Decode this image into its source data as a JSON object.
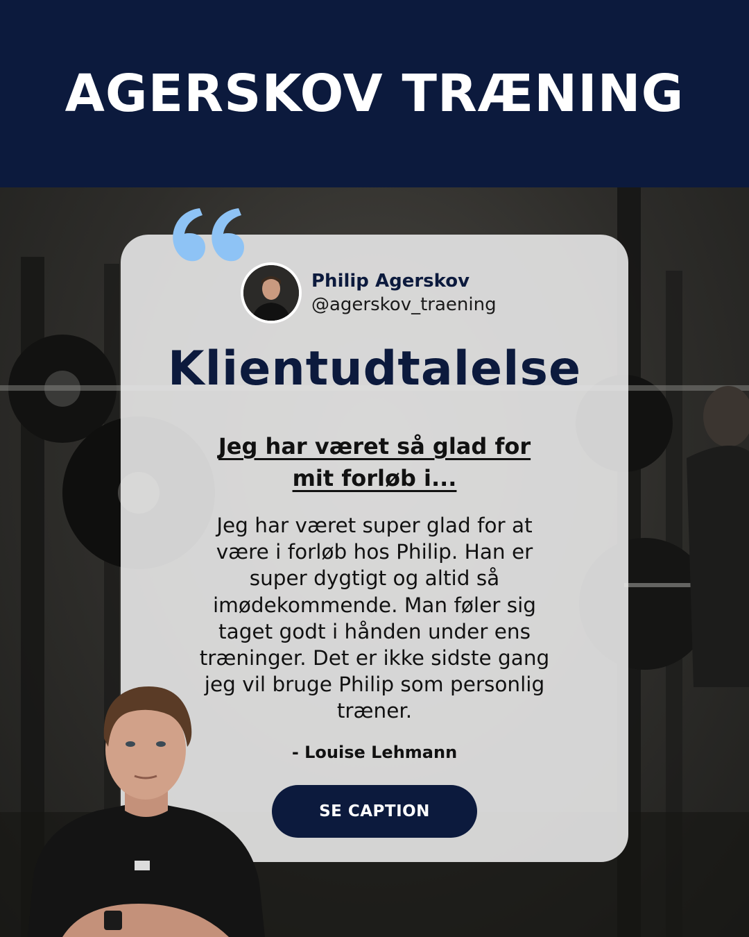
{
  "header": {
    "brand": "AGERSKOV TRÆNING",
    "background_color": "#0c1a3d"
  },
  "profile": {
    "name": "Philip Agerskov",
    "handle": "@agerskov_traening"
  },
  "card": {
    "title": "Klientudtalelse",
    "headline": "Jeg har været så glad for mit forløb i...",
    "body": "Jeg har været super glad for at være i forløb hos Philip. Han er super dygtigt og altid så imødekommende. Man føler sig taget godt i hånden under ens træninger. Det er ikke sidste gang jeg vil bruge Philip som personlig træner.",
    "author": "- Louise Lehmann",
    "cta_label": "SE CAPTION",
    "quote_color": "#8ec3f5"
  },
  "icons": {
    "quote": "quote-mark-icon",
    "avatar": "profile-avatar",
    "trainer": "trainer-photo"
  }
}
